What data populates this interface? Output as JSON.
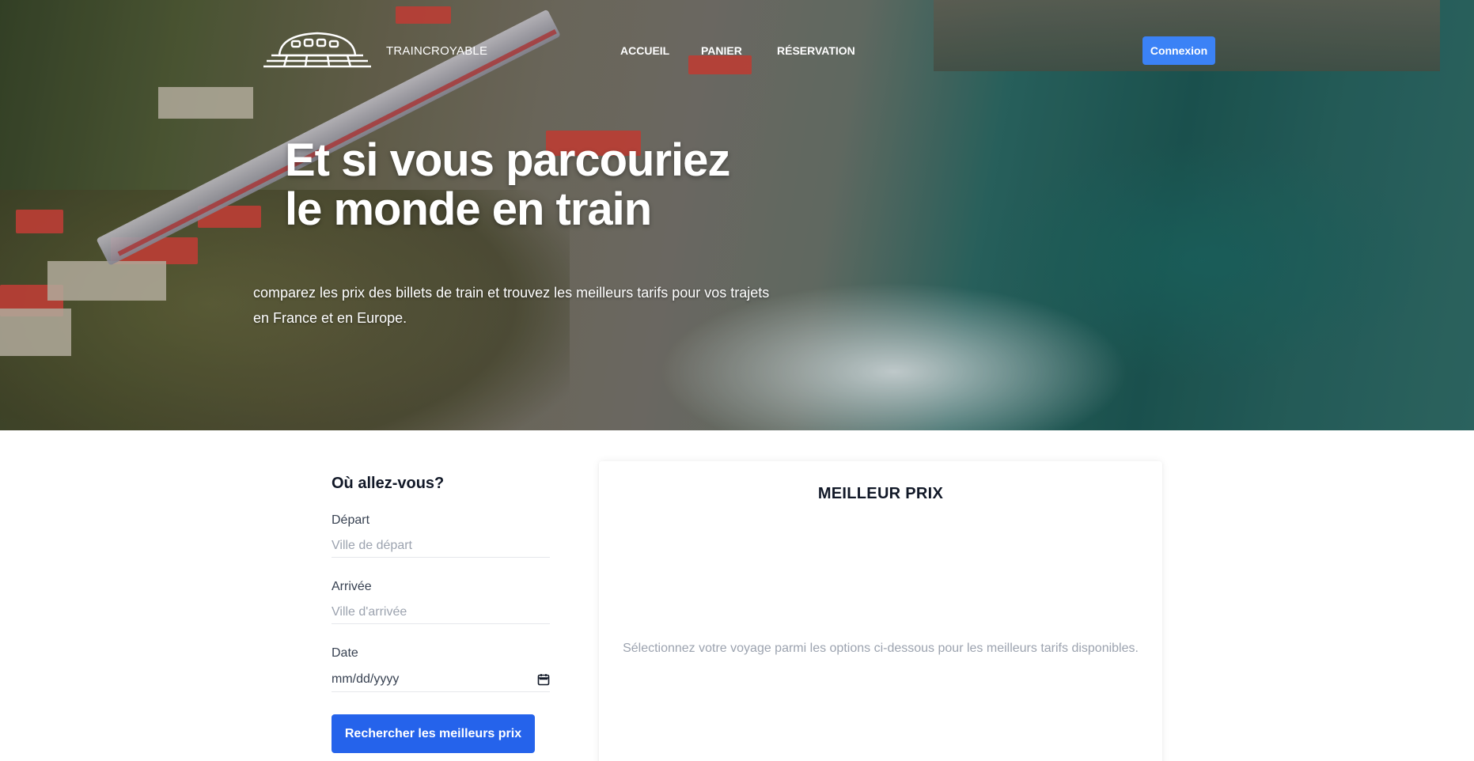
{
  "nav": {
    "brand": "TRAINCROYABLE",
    "logo_icon": "train-logo-icon",
    "links": [
      "ACCUEIL",
      "PANIER",
      "RÉSERVATION"
    ],
    "login_label": "Connexion"
  },
  "hero": {
    "title_line1": "Et si vous parcouriez",
    "title_line2": "le monde en train",
    "subtitle_line1": "comparez les prix des billets de train et trouvez les meilleurs tarifs pour vos trajets",
    "subtitle_line2": "en France et en Europe."
  },
  "search": {
    "title": "Où allez-vous?",
    "departure_label": "Départ",
    "departure_placeholder": "Ville de départ",
    "arrival_label": "Arrivée",
    "arrival_placeholder": "Ville d'arrivée",
    "date_label": "Date",
    "date_placeholder": "mm/dd/yyyy",
    "submit_label": "Rechercher les meilleurs prix"
  },
  "best_price": {
    "title": "MEILLEUR PRIX",
    "message": "Sélectionnez votre voyage parmi les options ci-dessous pour les meilleurs tarifs disponibles."
  },
  "colors": {
    "primary": "#2563eb",
    "login": "#3b82f6"
  }
}
